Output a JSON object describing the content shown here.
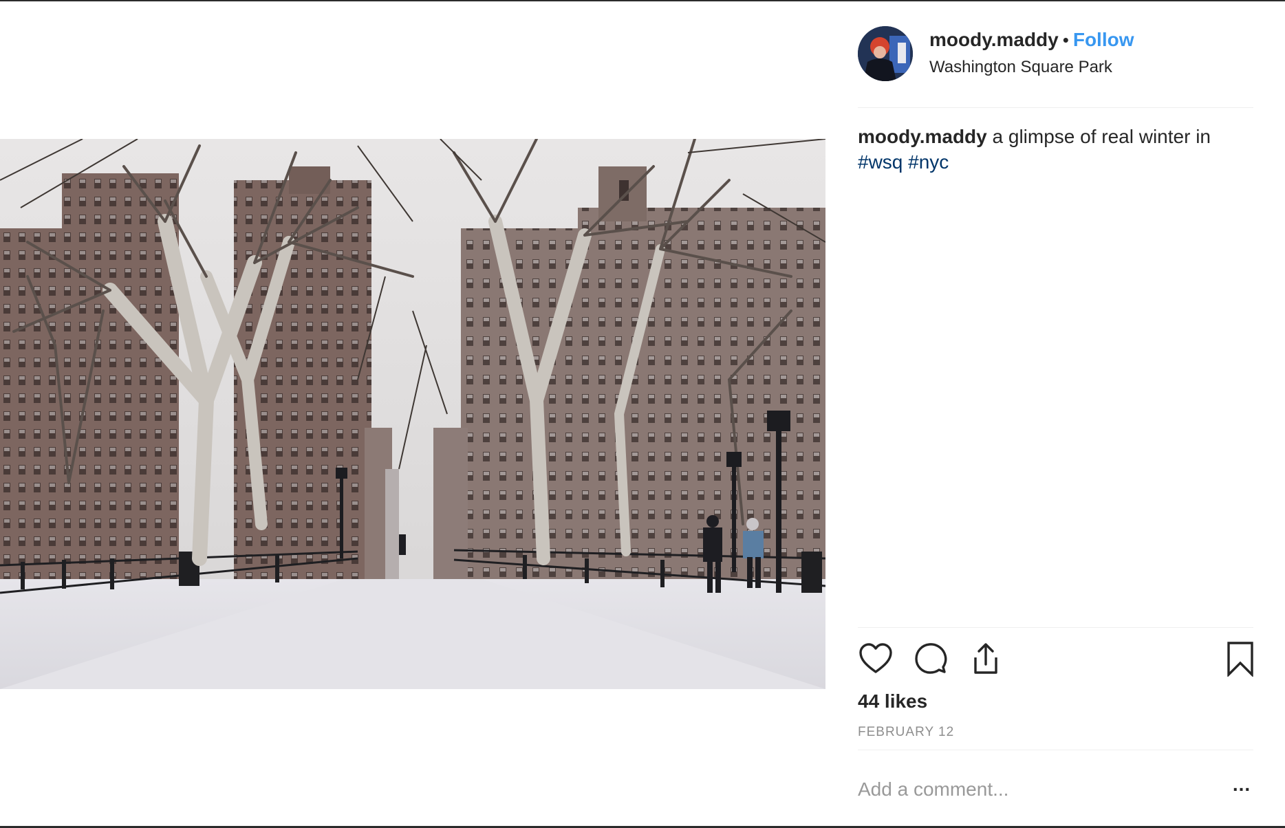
{
  "post": {
    "username": "moody.maddy",
    "separator": "•",
    "follow_label": "Follow",
    "location": "Washington Square Park",
    "caption": {
      "username": "moody.maddy",
      "text": "a glimpse of real winter in",
      "hashtags": [
        "#wsq",
        "#nyc"
      ]
    },
    "likes": "44 likes",
    "date": "FEBRUARY 12",
    "comment_placeholder": "Add a comment...",
    "more_label": "..."
  },
  "icons": {
    "like": "heart-icon",
    "comment": "comment-icon",
    "share": "share-icon",
    "save": "bookmark-icon",
    "more": "more-options-icon"
  },
  "colors": {
    "follow": "#3897f0",
    "hashtag": "#003569",
    "text": "#262626",
    "muted": "#8e8e8e",
    "divider": "#efefef"
  }
}
